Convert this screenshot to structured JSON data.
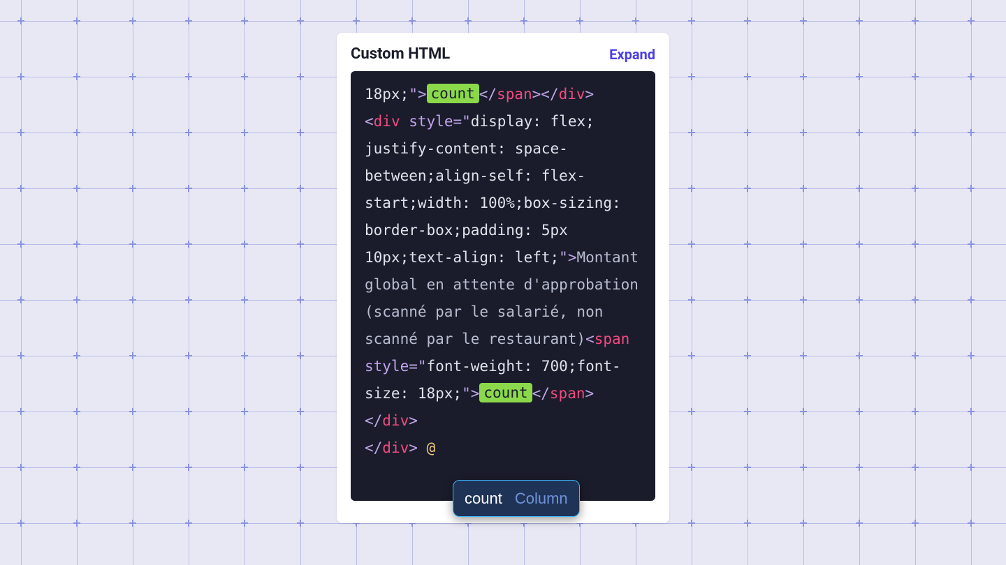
{
  "header": {
    "title": "Custom HTML",
    "expand_label": "Expand"
  },
  "code": {
    "line1_style_tail": "18px;",
    "chip1": "count",
    "close_span": "span",
    "close_div": "div",
    "open_div": "div",
    "style_attr": "style",
    "style2_value": "display: flex; justify-content: space-between;align-self: flex-start;width: 100%;box-sizing: border-box;padding: 5px 10px;text-align: left;",
    "text_body": "Montant global en attente d'approbation (scanné par le salarié, non scanné par le restaurant)",
    "open_span": "span",
    "style3_value": "font-weight: 700;font-size: 18px;",
    "chip2": "count",
    "trailing_at": "@"
  },
  "autocomplete": {
    "name": "count",
    "type": "Column"
  }
}
